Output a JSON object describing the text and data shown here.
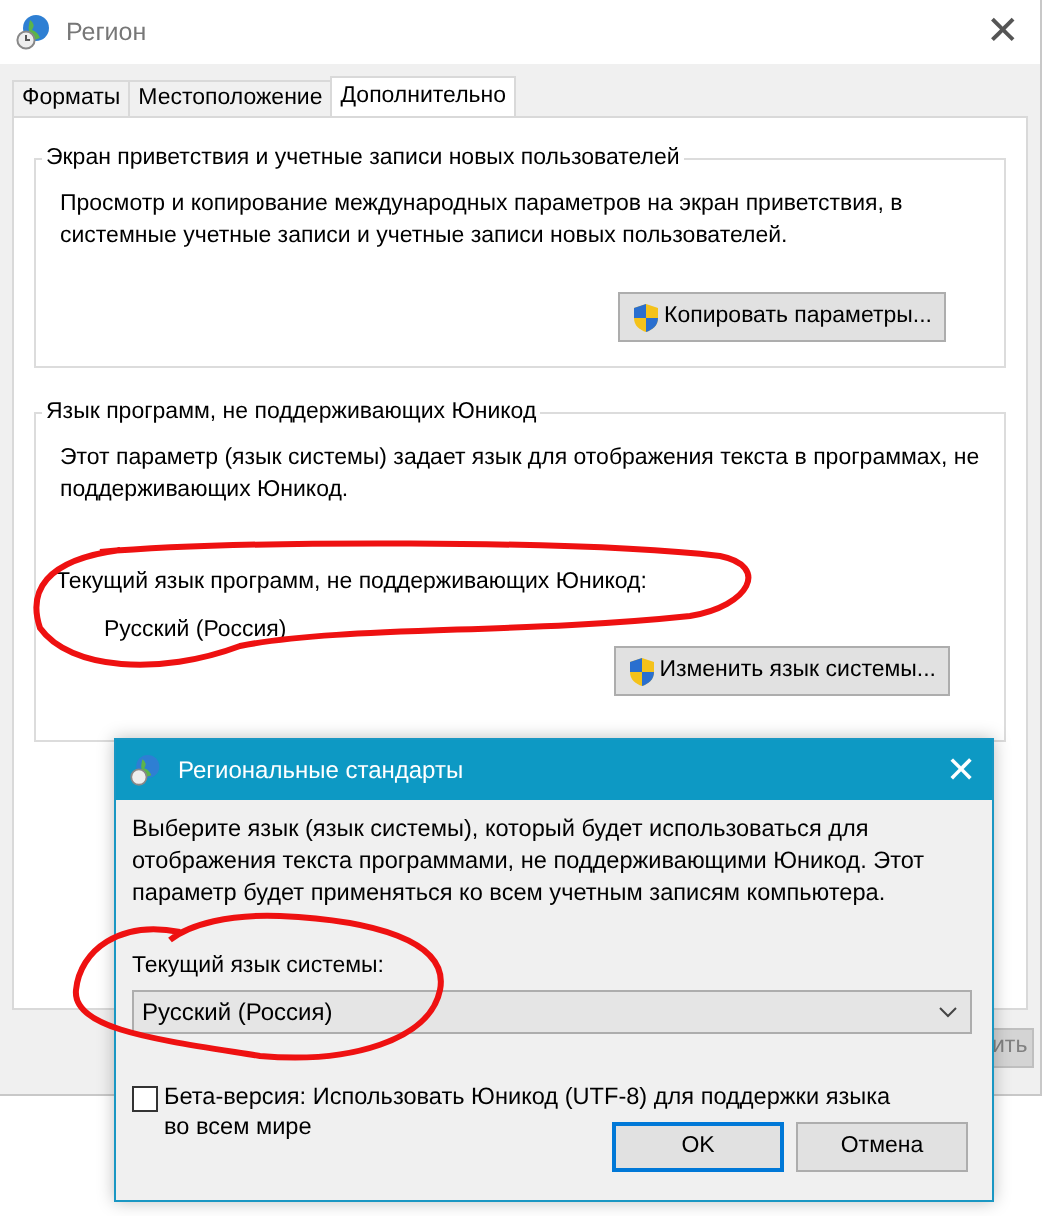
{
  "window": {
    "title": "Регион",
    "close": "✕"
  },
  "tabs": [
    {
      "label": "Форматы",
      "selected": false
    },
    {
      "label": "Местоположение",
      "selected": false
    },
    {
      "label": "Дополнительно",
      "selected": true
    }
  ],
  "welcome_group": {
    "title": "Экран приветствия и учетные записи новых пользователей",
    "description": "Просмотр и копирование международных параметров на экран приветствия, в системные учетные записи и учетные записи новых пользователей.",
    "button": "Копировать параметры..."
  },
  "non_unicode_group": {
    "title": "Язык программ, не поддерживающих Юникод",
    "description": "Этот параметр (язык системы) задает язык для отображения текста в программах, не поддерживающих Юникод.",
    "current_label": "Текущий язык программ, не поддерживающих Юникод:",
    "current_value": "Русский (Россия)",
    "button": "Изменить язык системы..."
  },
  "apply_button": "ить",
  "dialog": {
    "title": "Региональные стандарты",
    "close": "✕",
    "description": "Выберите язык (язык системы), который будет использоваться для отображения текста программами, не поддерживающими Юникод. Этот параметр будет применяться ко всем учетным записям компьютера.",
    "current_label": "Текущий язык системы:",
    "select_value": "Русский (Россия)",
    "beta_checkbox": {
      "label": "Бета-версия: Использовать Юникод (UTF-8) для поддержки языка во всем мире",
      "checked": false
    },
    "buttons": [
      {
        "label": "OK",
        "default": true
      },
      {
        "label": "Отмена",
        "default": false
      }
    ]
  },
  "annotations": [
    {
      "kind": "loop"
    },
    {
      "kind": "loop"
    }
  ]
}
